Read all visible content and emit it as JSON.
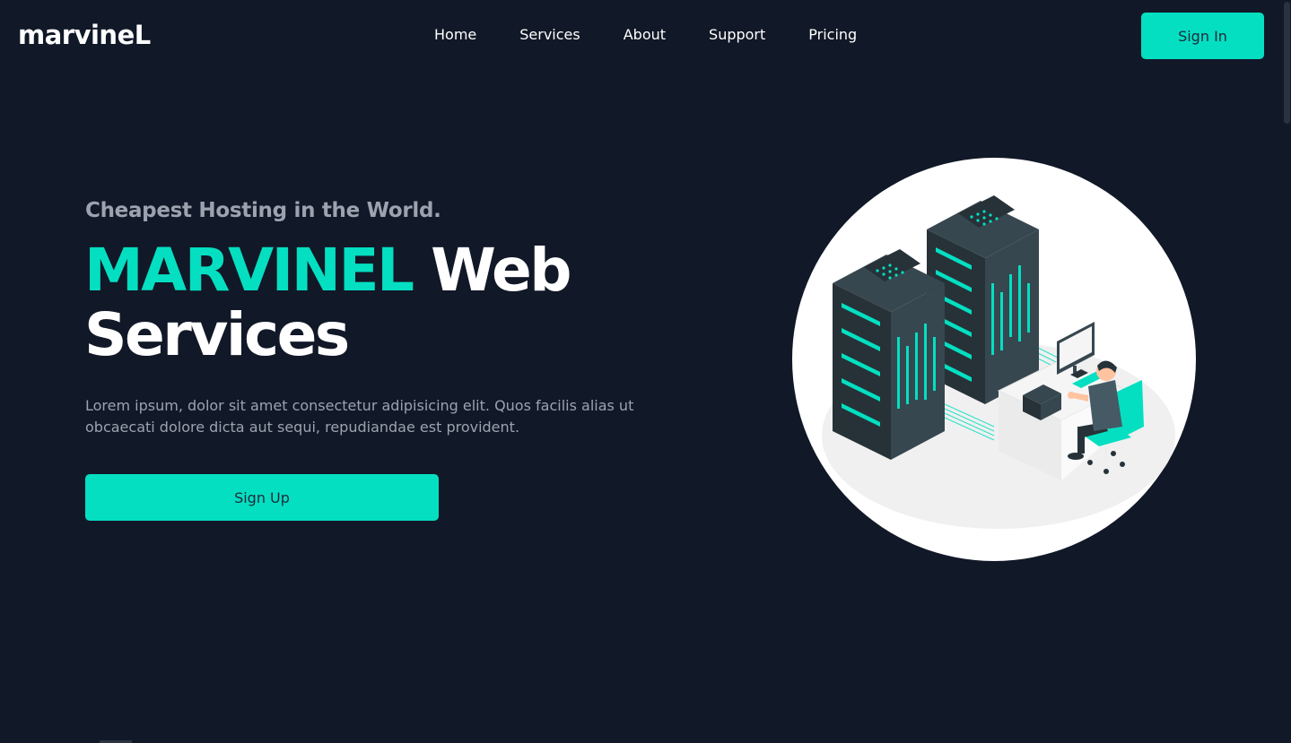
{
  "brand": {
    "logo_text": "marvineL"
  },
  "nav": {
    "items": [
      {
        "label": "Home"
      },
      {
        "label": "Services"
      },
      {
        "label": "About"
      },
      {
        "label": "Support"
      },
      {
        "label": "Pricing"
      }
    ]
  },
  "header": {
    "signin_label": "Sign In"
  },
  "hero": {
    "tagline": "Cheapest Hosting in the World.",
    "title_highlight": "MARVINEL",
    "title_rest_line1": "Web",
    "title_line2": "Services",
    "description": "Lorem ipsum, dolor sit amet consectetur adipisicing elit. Quos facilis alias ut obcaecati dolore dicta aut sequi, repudiandae est provident.",
    "signup_label": "Sign Up",
    "illustration_icon": "server-rack-illustration"
  },
  "colors": {
    "background": "#111827",
    "accent": "#04dfc1",
    "text_primary": "#ffffff",
    "text_muted": "#9ca3af",
    "button_text": "#1e293b"
  }
}
